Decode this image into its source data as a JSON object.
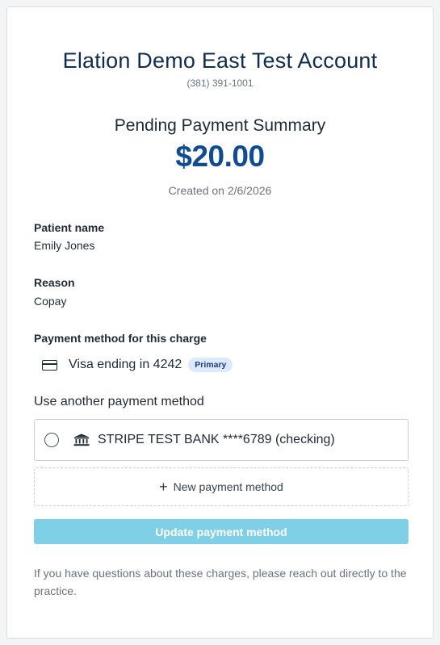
{
  "account": {
    "name": "Elation Demo East Test Account",
    "phone": "(381) 391-1001"
  },
  "summary": {
    "title": "Pending Payment Summary",
    "amount": "$20.00",
    "created": "Created on 2/6/2026"
  },
  "fields": {
    "patient_label": "Patient name",
    "patient_value": "Emily Jones",
    "reason_label": "Reason",
    "reason_value": "Copay",
    "payment_method_label": "Payment method for this charge"
  },
  "current_method": {
    "icon": "credit-card-icon",
    "label": "Visa ending in 4242",
    "badge": "Primary"
  },
  "other_methods": {
    "title": "Use another payment method",
    "options": [
      {
        "icon": "bank-icon",
        "label": "STRIPE TEST BANK ****6789 (checking)",
        "selected": false
      }
    ],
    "new_label": "New payment method"
  },
  "actions": {
    "update_label": "Update payment method"
  },
  "footer": {
    "note": "If you have questions about these charges, please reach out directly to the practice."
  },
  "colors": {
    "brand_navy": "#0f2d52",
    "amount_blue": "#0f4c92",
    "button_disabled": "#7fcfe6",
    "badge_bg": "#dbeafe"
  }
}
